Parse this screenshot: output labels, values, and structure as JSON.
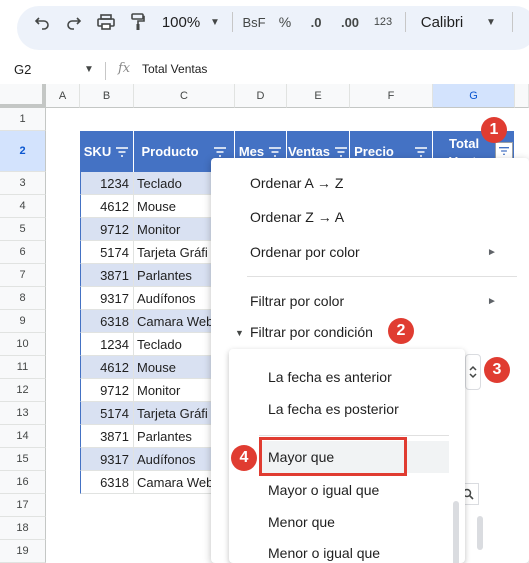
{
  "toolbar": {
    "zoom": "100%",
    "currency_btn": "BsF",
    "percent_btn": "%",
    "decrease_decimals": ".0",
    "increase_decimals": ".00",
    "number_format": "123",
    "font": "Calibri"
  },
  "formula_bar": {
    "name_box": "G2",
    "fx": "fx",
    "formula": "Total Ventas"
  },
  "columns": [
    "A",
    "B",
    "C",
    "D",
    "E",
    "F",
    "G"
  ],
  "rows": [
    "1",
    "2",
    "3",
    "4",
    "5",
    "6",
    "7",
    "8",
    "9",
    "10",
    "11",
    "12",
    "13",
    "14",
    "15",
    "16",
    "17",
    "18",
    "19"
  ],
  "table": {
    "headers": {
      "sku": "SKU",
      "producto": "Producto",
      "mes": "Mes",
      "ventas": "Ventas",
      "precio": "Precio",
      "total": "Total",
      "total_2": "Ventas"
    },
    "rows": [
      {
        "sku": "1234",
        "producto": "Teclado"
      },
      {
        "sku": "4612",
        "producto": "Mouse"
      },
      {
        "sku": "9712",
        "producto": "Monitor"
      },
      {
        "sku": "5174",
        "producto": "Tarjeta Gráfi"
      },
      {
        "sku": "3871",
        "producto": "Parlantes"
      },
      {
        "sku": "9317",
        "producto": "Audífonos"
      },
      {
        "sku": "6318",
        "producto": "Camara Web"
      },
      {
        "sku": "1234",
        "producto": "Teclado"
      },
      {
        "sku": "4612",
        "producto": "Mouse"
      },
      {
        "sku": "9712",
        "producto": "Monitor"
      },
      {
        "sku": "5174",
        "producto": "Tarjeta Gráfi"
      },
      {
        "sku": "3871",
        "producto": "Parlantes"
      },
      {
        "sku": "9317",
        "producto": "Audífonos"
      },
      {
        "sku": "6318",
        "producto": "Camara Web"
      }
    ]
  },
  "menu": {
    "sort_az": "Ordenar A → Z",
    "sort_za": "Ordenar Z → A",
    "sort_color": "Ordenar por color",
    "filter_color": "Filtrar por color",
    "filter_condition": "Filtrar por condición"
  },
  "conditions": {
    "date_before": "La fecha es anterior",
    "date_after": "La fecha es posterior",
    "greater": "Mayor que",
    "greater_equal": "Mayor o igual que",
    "less": "Menor que",
    "less_equal": "Menor o igual que"
  },
  "callouts": [
    "1",
    "2",
    "3",
    "4"
  ],
  "colors": {
    "header_blue": "#4472c4",
    "band_blue": "#d9e1f2",
    "callout_red": "#e03c31"
  }
}
